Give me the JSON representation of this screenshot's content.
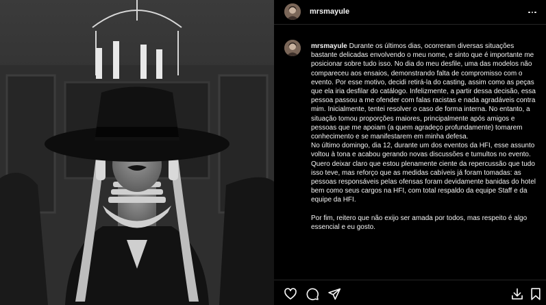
{
  "post": {
    "username": "mrsmayule"
  },
  "caption": {
    "username": "mrsmayule",
    "paragraphs": [
      "Durante os últimos dias, ocorreram diversas situações bastante delicadas envolvendo o meu nome, e sinto que é importante me posicionar sobre tudo isso. No dia do meu desfile, uma das modelos não compareceu aos ensaios, demonstrando falta de compromisso com o evento. Por esse motivo, decidi retirá-la do casting, assim como as peças que ela iria desfilar do catálogo. Infelizmente, a partir dessa decisão, essa pessoa passou a me ofender com falas racistas e nada agradáveis contra mim. Inicialmente, tentei resolver o caso de forma interna. No entanto, a situação tomou proporções maiores, principalmente após amigos e pessoas que me apoiam (a quem agradeço profundamente) tomarem conhecimento e se manifestarem em minha defesa.",
      "No último domingo, dia 12, durante um dos eventos da HFI, esse assunto voltou à tona e acabou gerando novas discussões e tumultos no evento. Quero deixar claro que estou plenamente ciente da repercussão que tudo isso teve, mas reforço que as medidas cabíveis já foram tomadas: as pessoas responsáveis pelas ofensas foram devidamente banidas do hotel bem como seus cargos na HFI, com total respaldo da equipe Staff e da equipe da HFI.",
      "Por fim, reitero que não exijo ser amada por todos, mas respeito é algo essencial e eu gosto."
    ]
  },
  "icons": {
    "more": "more-horizontal-icon",
    "like": "heart-icon",
    "comment": "comment-icon",
    "share": "send-icon",
    "download": "download-icon",
    "save": "bookmark-icon"
  },
  "colors": {
    "background": "#000000",
    "text": "#f5f5f5",
    "divider": "#262626"
  }
}
